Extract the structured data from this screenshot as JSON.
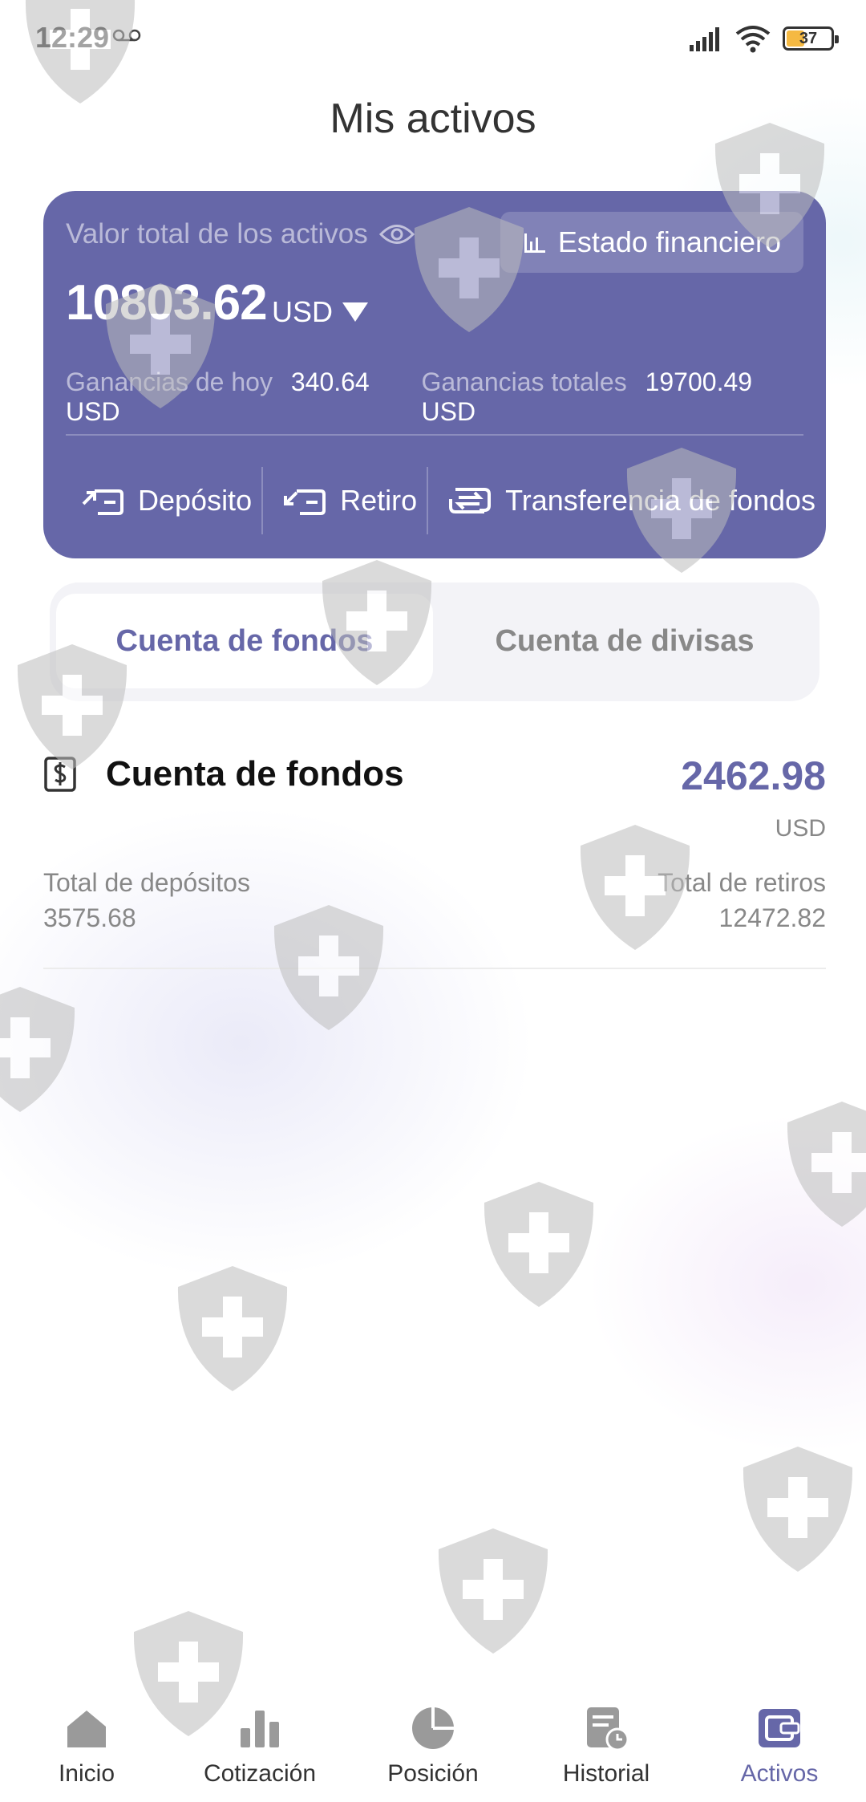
{
  "status": {
    "time": "12:29",
    "battery": "37"
  },
  "page": {
    "title": "Mis activos"
  },
  "asset_card": {
    "label": "Valor total de los activos",
    "statement_button": "Estado financiero",
    "total_value": "10803.62",
    "currency": "USD",
    "today_label": "Ganancias de hoy",
    "today_value": "340.64 USD",
    "total_gain_label": "Ganancias totales",
    "total_gain_value": "19700.49 USD",
    "actions": {
      "deposit": "Depósito",
      "withdraw": "Retiro",
      "transfer": "Transferencia de fondos"
    },
    "card_color": "#6667a8"
  },
  "tabs": {
    "active": "Cuenta de fondos",
    "inactive": "Cuenta de divisas"
  },
  "fund_account": {
    "title": "Cuenta de fondos",
    "amount": "2462.98",
    "unit": "USD",
    "deposits_label": "Total de depósitos",
    "deposits_value": "3575.68",
    "withdrawals_label": "Total de retiros",
    "withdrawals_value": "12472.82"
  },
  "nav": {
    "items": [
      {
        "label": "Inicio",
        "icon": "home-icon"
      },
      {
        "label": "Cotización",
        "icon": "bar-chart-icon"
      },
      {
        "label": "Posición",
        "icon": "pie-chart-icon"
      },
      {
        "label": "Historial",
        "icon": "history-icon"
      },
      {
        "label": "Activos",
        "icon": "wallet-icon"
      }
    ],
    "active_index": 4,
    "active_color": "#6667a8"
  }
}
